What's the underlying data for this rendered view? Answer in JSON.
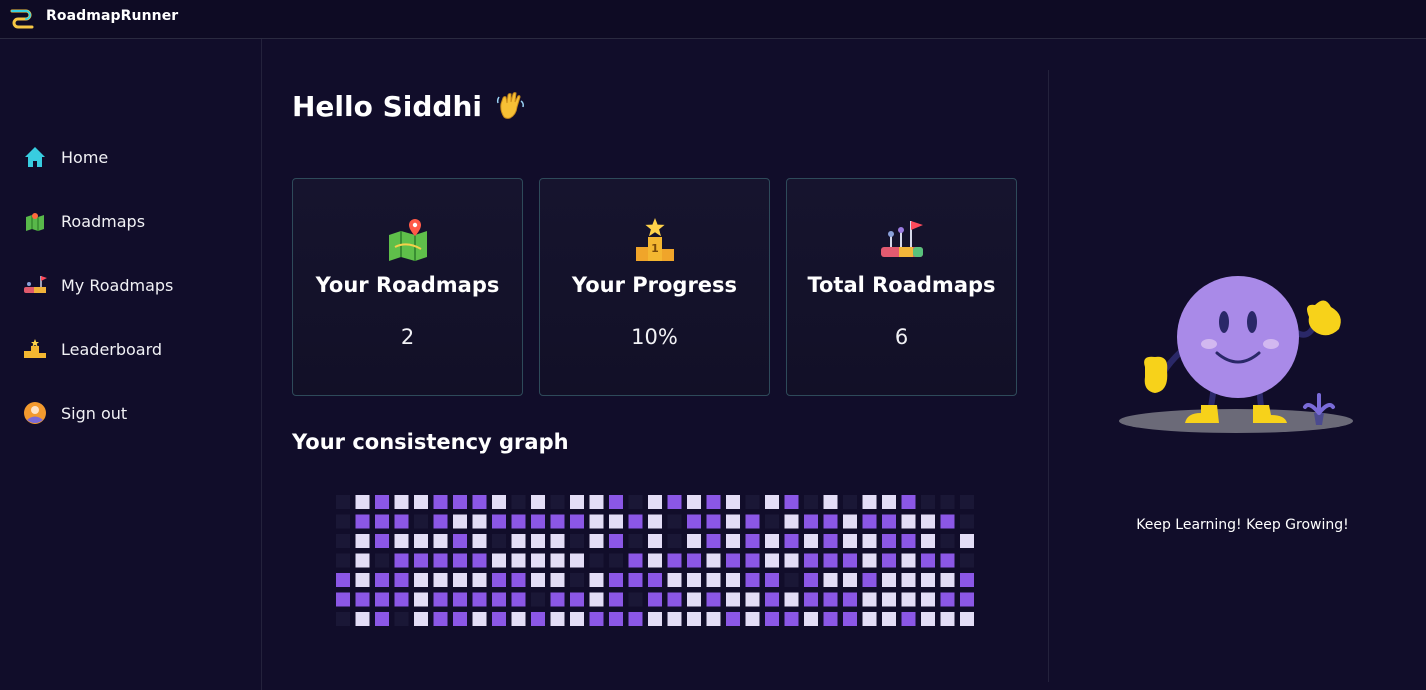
{
  "app": {
    "title": "RoadmapRunner"
  },
  "sidebar": {
    "items": [
      {
        "label": "Home",
        "icon": "home-icon"
      },
      {
        "label": "Roadmaps",
        "icon": "map-icon"
      },
      {
        "label": "My Roadmaps",
        "icon": "flag-road-icon"
      },
      {
        "label": "Leaderboard",
        "icon": "podium-icon"
      },
      {
        "label": "Sign out",
        "icon": "user-avatar-icon"
      }
    ]
  },
  "main": {
    "greeting": "Hello Siddhi",
    "greeting_icon": "waving-hand-icon",
    "cards": [
      {
        "title": "Your Roadmaps",
        "value": "2",
        "icon": "map-pin-icon"
      },
      {
        "title": "Your Progress",
        "value": "10%",
        "icon": "podium-star-icon"
      },
      {
        "title": "Total Roadmaps",
        "value": "6",
        "icon": "roadmap-flag-icon"
      }
    ],
    "consistency_title": "Your consistency graph",
    "consistency_grid": {
      "rows": 7,
      "cols": 33,
      "colors": {
        "empty": "#1a1736",
        "light": "#e3ddf6",
        "purple": "#8b57e6"
      },
      "cells": [
        "0L P L L P P P L 0 L 0 L L P 0 L P L P L 0 L P 0 L 0 L L P 0 0 0 0",
        "0P P P 0 P L L P P P P P L L P L 0 P P L P 0 L P P L P P L L P 0 L",
        "0L P L L L P L 0 L L L 0 L P 0 L 0 L P L P L P L P L L P P L 0 L P",
        "0L 0 P P P P P L L L L L 0 0 P L P P L P P L L P P P L P L P P 0 0",
        "P L P P L L L L P P L L 0 L P P P L L L L P P 0 P L L P L L L L P",
        "P P P P L P P P P P 0 P P L P 0 P P L P L L P L P P P L L L L P P",
        "0L P 0 L P P L P L P L L P P P L L L L P L P P L P P L L P L L L"
      ]
    }
  },
  "right_panel": {
    "caption": "Keep Learning! Keep Growing!",
    "illustration": "smiley-mascot-illustration"
  }
}
